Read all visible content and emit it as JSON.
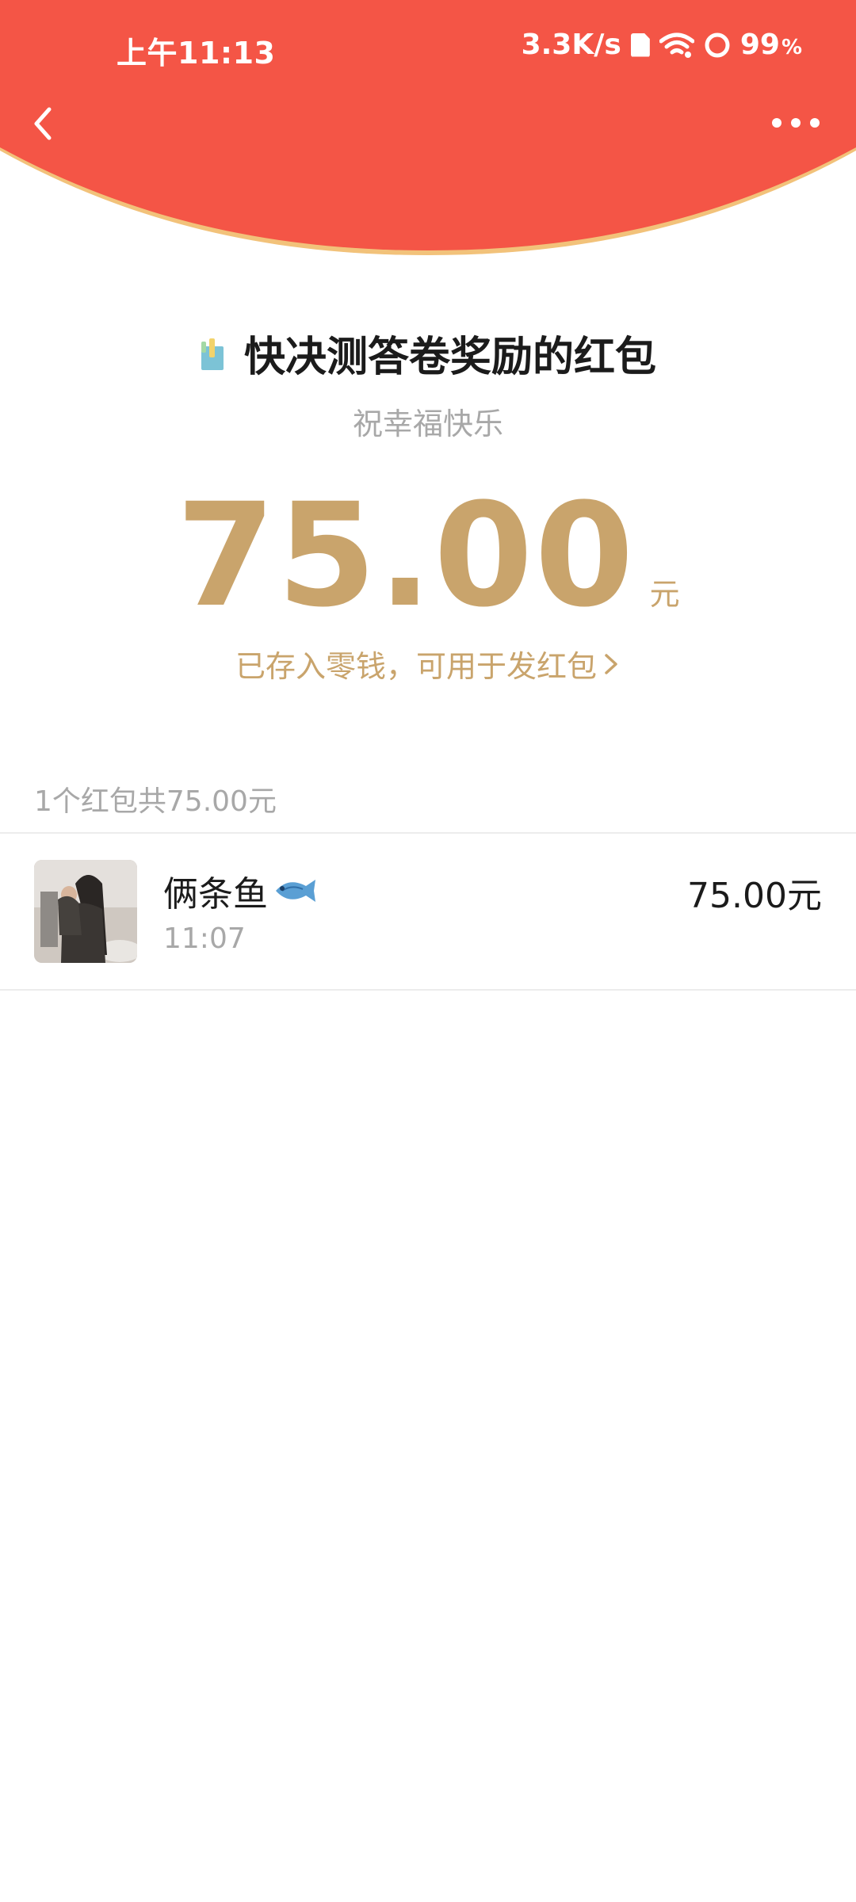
{
  "status_bar": {
    "time": "上午11:13",
    "net_speed": "3.3K/s",
    "battery": "99",
    "battery_unit": "%"
  },
  "nav": {
    "back_icon": "chevron-left-icon",
    "more_icon": "more-dots-icon"
  },
  "envelope": {
    "title": "快决测答卷奖励的红包",
    "blessing": "祝幸福快乐",
    "amount": "75.00",
    "unit": "元",
    "change_link": "已存入零钱，可用于发红包"
  },
  "summary": "1个红包共75.00元",
  "records": [
    {
      "name": "俩条鱼",
      "time": "11:07",
      "amount": "75.00元"
    }
  ],
  "colors": {
    "header_red": "#F45546",
    "header_edge": "#F2C27A",
    "gold": "#C9A46C"
  }
}
